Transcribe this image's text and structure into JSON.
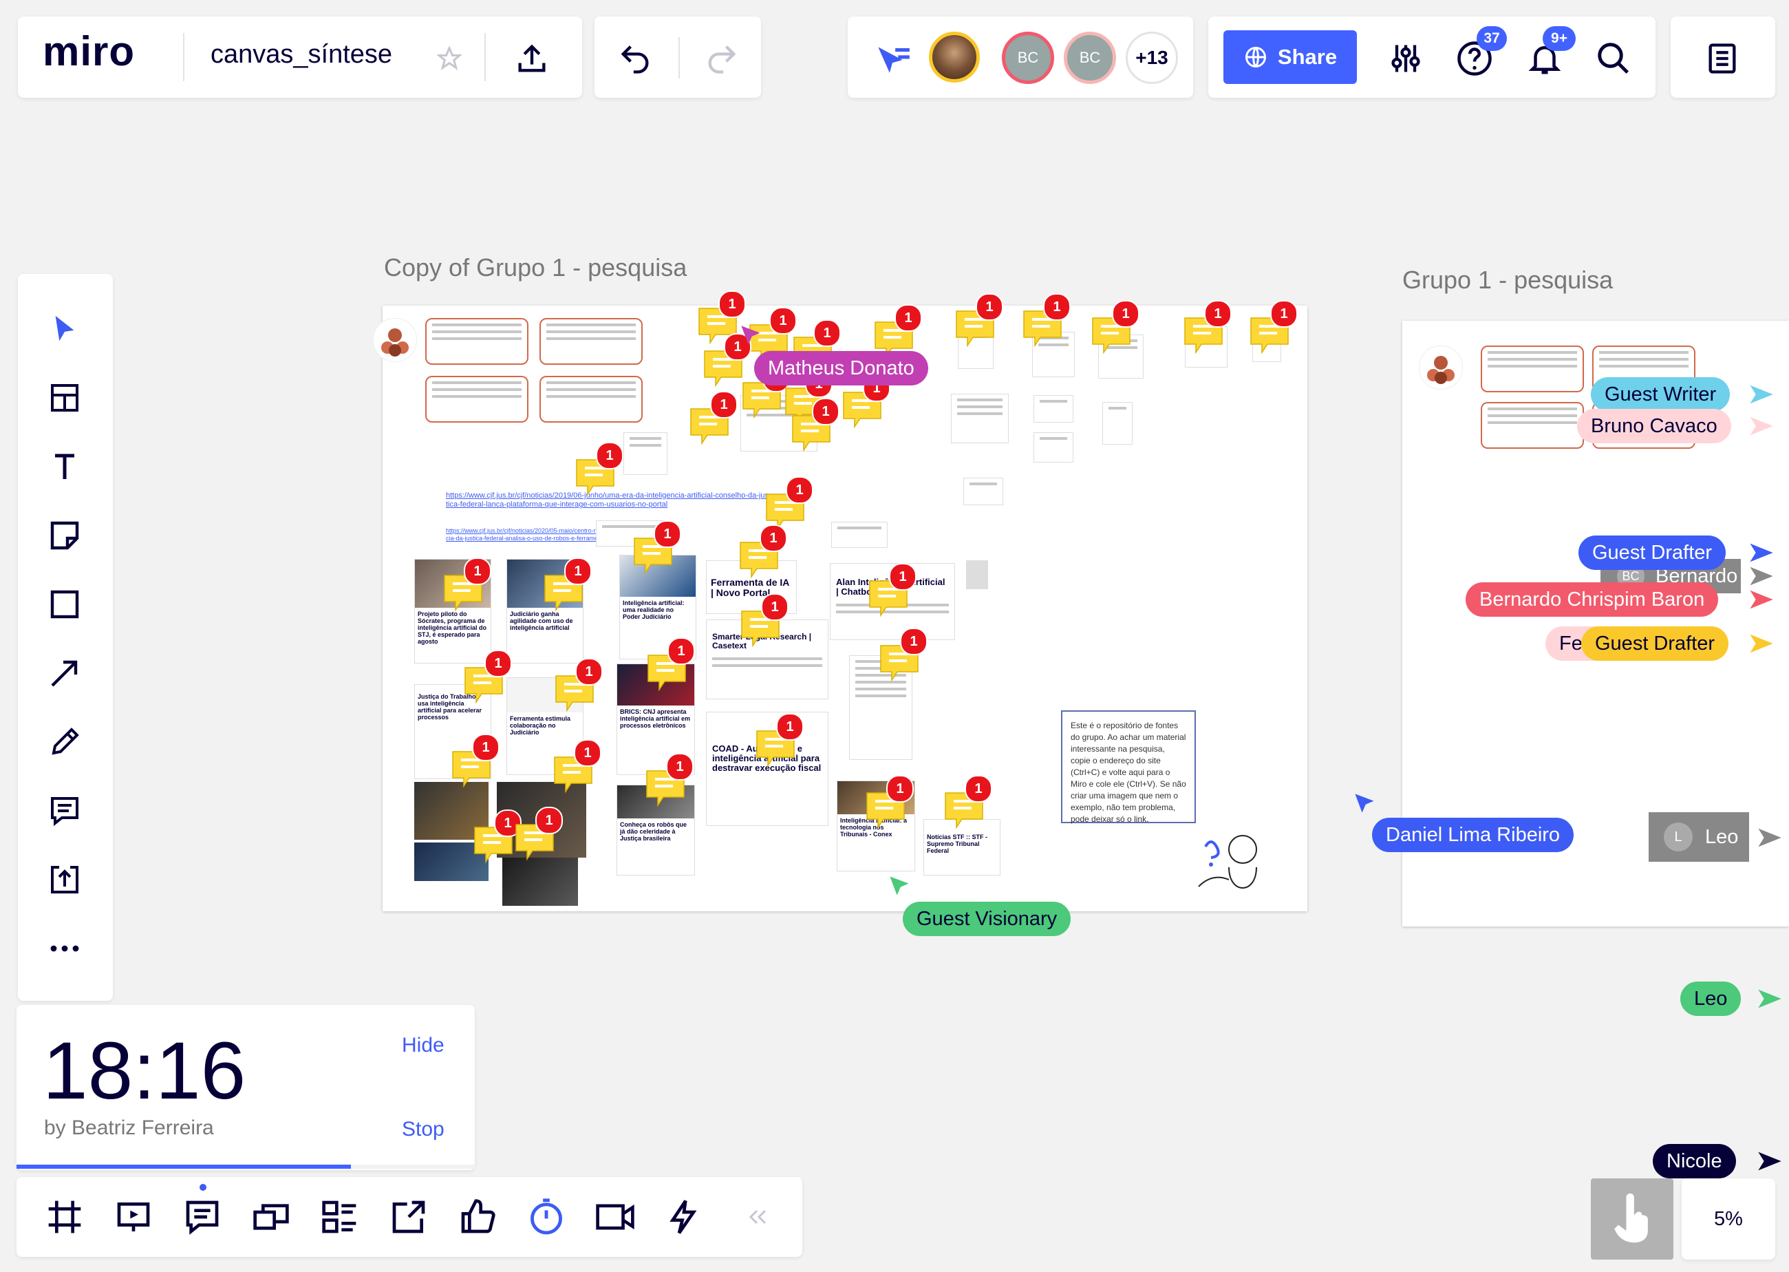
{
  "board": {
    "logo": "miro",
    "name": "canvas_síntese",
    "share_label": "Share",
    "help_badge": "37",
    "notif_badge": "9+",
    "collab_more": "+13",
    "avatars": [
      {
        "initials": "BC"
      },
      {
        "initials": "BC"
      }
    ]
  },
  "frames": [
    {
      "title": "Copy of Grupo 1 - pesquisa"
    },
    {
      "title": "Grupo 1 - pesquisa"
    }
  ],
  "cursors": [
    {
      "name": "Matheus Donato",
      "color": "#c13fb3"
    },
    {
      "name": "Guest Visionary",
      "color": "#4cc97a"
    },
    {
      "name": "Daniel Lima Ribeiro",
      "color": "#3d5cf5"
    },
    {
      "name": "Guest Writer",
      "color": "#6fd0ec"
    },
    {
      "name": "Bruno Cavaco",
      "color": "#ffd5d9"
    },
    {
      "name": "Guest Drafter",
      "color": "#3d5cf5"
    },
    {
      "name": "Bernardo",
      "color": "#888888"
    },
    {
      "name": "Bernardo Chrispim Baron",
      "color": "#f25a6b"
    },
    {
      "name": "Fe",
      "color": "#ffd5d9"
    },
    {
      "name": "Guest Drafter",
      "color": "#fbc82b"
    },
    {
      "name": "Leo",
      "color": "#888888"
    },
    {
      "name": "Leo",
      "color": "#4cc97a"
    },
    {
      "name": "Nicole",
      "color": "#050038"
    }
  ],
  "cursor_avatar_initials": {
    "bernardo": "BC",
    "leo": "L"
  },
  "frame_content": {
    "link1": "https://www.cjf.jus.br/cjf/noticias/2019/06-junho/uma-era-da-inteligencia-artificial-conselho-da-justica-federal-lanca-plataforma-que-interage-com-usuarios-no-portal",
    "link2": "https://www.cjf.jus.br/cjf/noticias/2020/05-maio/centro-nacional-de-inteligencia-da-justica-federal-analisa-o-uso-de-robos-e-ferramentas",
    "cards": [
      "Projeto piloto do Sócrates, programa de inteligência artificial do STJ, é esperado para agosto",
      "Judiciário ganha agilidade com uso de inteligência artificial",
      "Inteligência artificial: uma realidade no Poder Judiciário",
      "Ferramenta de IA | Novo Portal",
      "Alan Inteligência Artificial | Chatbot",
      "Smarter Legal Research | Casetext",
      "Justiça do Trabalho usa inteligência artificial para acelerar processos",
      "Ferramenta estimula colaboração no Judiciário",
      "BRICS: CNJ apresenta inteligência artificial em processos eletrônicos",
      "COAD - Automação e inteligência artificial para destravar execução fiscal",
      "Conheça os robôs que já dão celeridade à Justiça brasileira",
      "Inteligência artificial: a tecnologia nos Tribunais - Conex",
      "Notícias STF :: STF - Supremo Tribunal Federal"
    ],
    "instructions": "Este é o repositório de fontes do grupo. Ao achar um material interessante na pesquisa, copie o endereço do site (Ctrl+C) e volte aqui para o Miro e cole ele (Ctrl+V). Se não criar uma imagem que nem o exemplo, não tem problema, pode deixar só o link.",
    "comment_badge": "1"
  },
  "timer": {
    "time": "18:16",
    "by": "by Beatriz Ferreira",
    "hide_label": "Hide",
    "stop_label": "Stop",
    "progress": 0.73
  },
  "left_tools": [
    "cursor-icon",
    "frame-template-icon",
    "text-icon",
    "sticky-note-icon",
    "shape-icon",
    "arrow-icon",
    "pen-icon",
    "comment-icon",
    "upload-icon",
    "more-icon"
  ],
  "bottom_tools": [
    "frame-icon",
    "presentation-icon",
    "comments-icon",
    "cards-icon",
    "list-icon",
    "export-icon",
    "vote-icon",
    "timer-icon",
    "video-icon",
    "bolt-icon"
  ],
  "zoom": "5%",
  "colors": {
    "accent": "#4262ff",
    "badge_red": "#e8141c",
    "comment_yellow": "#fdd835"
  }
}
